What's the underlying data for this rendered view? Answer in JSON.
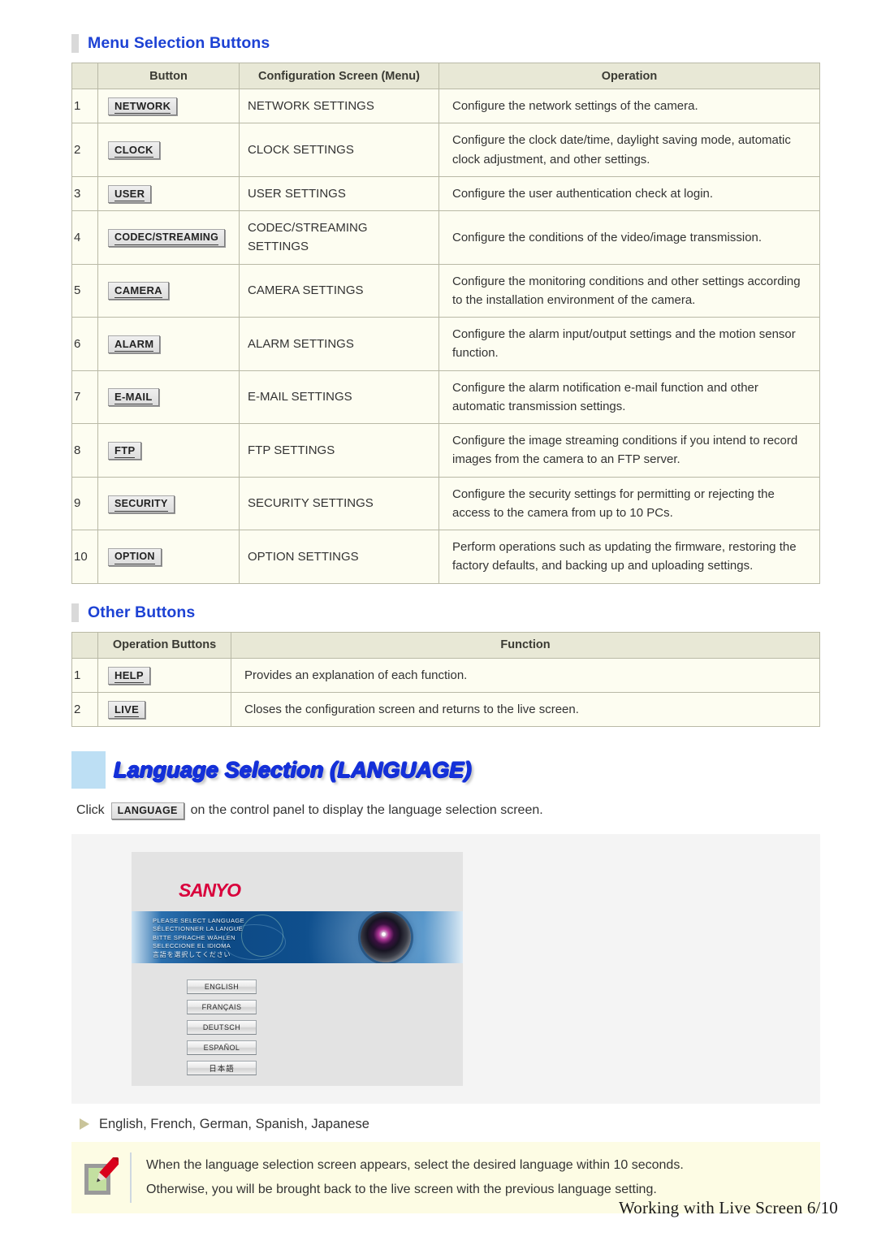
{
  "menu_section": {
    "heading": "Menu Selection Buttons",
    "columns": [
      "",
      "Button",
      "Configuration Screen (Menu)",
      "Operation"
    ],
    "rows": [
      {
        "num": "1",
        "button": "NETWORK",
        "screen": "NETWORK SETTINGS",
        "operation": "Configure the network settings of the camera."
      },
      {
        "num": "2",
        "button": "CLOCK",
        "screen": "CLOCK SETTINGS",
        "operation": "Configure the clock date/time, daylight saving mode, automatic clock adjustment, and other settings."
      },
      {
        "num": "3",
        "button": "USER",
        "screen": "USER SETTINGS",
        "operation": "Configure the user authentication check at login."
      },
      {
        "num": "4",
        "button": "CODEC/STREAMING",
        "screen": "CODEC/STREAMING SETTINGS",
        "operation": "Configure the conditions of the video/image transmission."
      },
      {
        "num": "5",
        "button": "CAMERA",
        "screen": "CAMERA SETTINGS",
        "operation": "Configure the monitoring conditions and other settings according to the installation environment of the camera."
      },
      {
        "num": "6",
        "button": "ALARM",
        "screen": "ALARM SETTINGS",
        "operation": "Configure the alarm input/output settings and the motion sensor function."
      },
      {
        "num": "7",
        "button": "E-MAIL",
        "screen": "E-MAIL SETTINGS",
        "operation": "Configure the alarm notification e-mail function and other automatic transmission settings."
      },
      {
        "num": "8",
        "button": "FTP",
        "screen": "FTP SETTINGS",
        "operation": "Configure the image streaming conditions if you intend to record images from the camera to an FTP server."
      },
      {
        "num": "9",
        "button": "SECURITY",
        "screen": "SECURITY SETTINGS",
        "operation": "Configure the security settings for permitting or rejecting the access to the camera from up to 10 PCs."
      },
      {
        "num": "10",
        "button": "OPTION",
        "screen": "OPTION SETTINGS",
        "operation": "Perform operations such as updating the firmware, restoring the factory defaults, and backing up and uploading settings."
      }
    ]
  },
  "other_section": {
    "heading": "Other Buttons",
    "columns": [
      "",
      "Operation Buttons",
      "Function"
    ],
    "rows": [
      {
        "num": "1",
        "button": "HELP",
        "function": "Provides an explanation of each function."
      },
      {
        "num": "2",
        "button": "LIVE",
        "function": "Closes the configuration screen and returns to the live screen."
      }
    ]
  },
  "language_section": {
    "banner_title": "Language Selection (LANGUAGE)",
    "click_prefix": "Click",
    "click_button": "LANGUAGE",
    "click_suffix": "on the control panel to display the language selection screen.",
    "screenshot": {
      "logo": "SANYO",
      "prompt_lines": [
        "PLEASE SELECT LANGUAGE",
        "SÉLECTIONNER LA LANGUE",
        "BITTE SPRACHE WÄHLEN",
        "SELECCIONE EL IDIOMA",
        "言語を選択してください"
      ],
      "buttons": [
        "ENGLISH",
        "FRANÇAIS",
        "DEUTSCH",
        "ESPAÑOL",
        "日本語"
      ]
    },
    "bullet": "English, French, German, Spanish, Japanese",
    "note_lines": [
      "When the language selection screen appears, select the desired language within 10 seconds.",
      "Otherwise, you will be brought back to the live screen with the previous language setting."
    ]
  },
  "footer": "Working with Live Screen 6/10",
  "colors": {
    "heading_blue": "#1d42d4",
    "banner_blue": "#1430d8",
    "banner_block": "#bddff4",
    "table_header_bg": "#e8e8d6",
    "table_body_bg": "#fdfdf1",
    "note_bg": "#fdfce4",
    "logo_red": "#d9003c"
  }
}
